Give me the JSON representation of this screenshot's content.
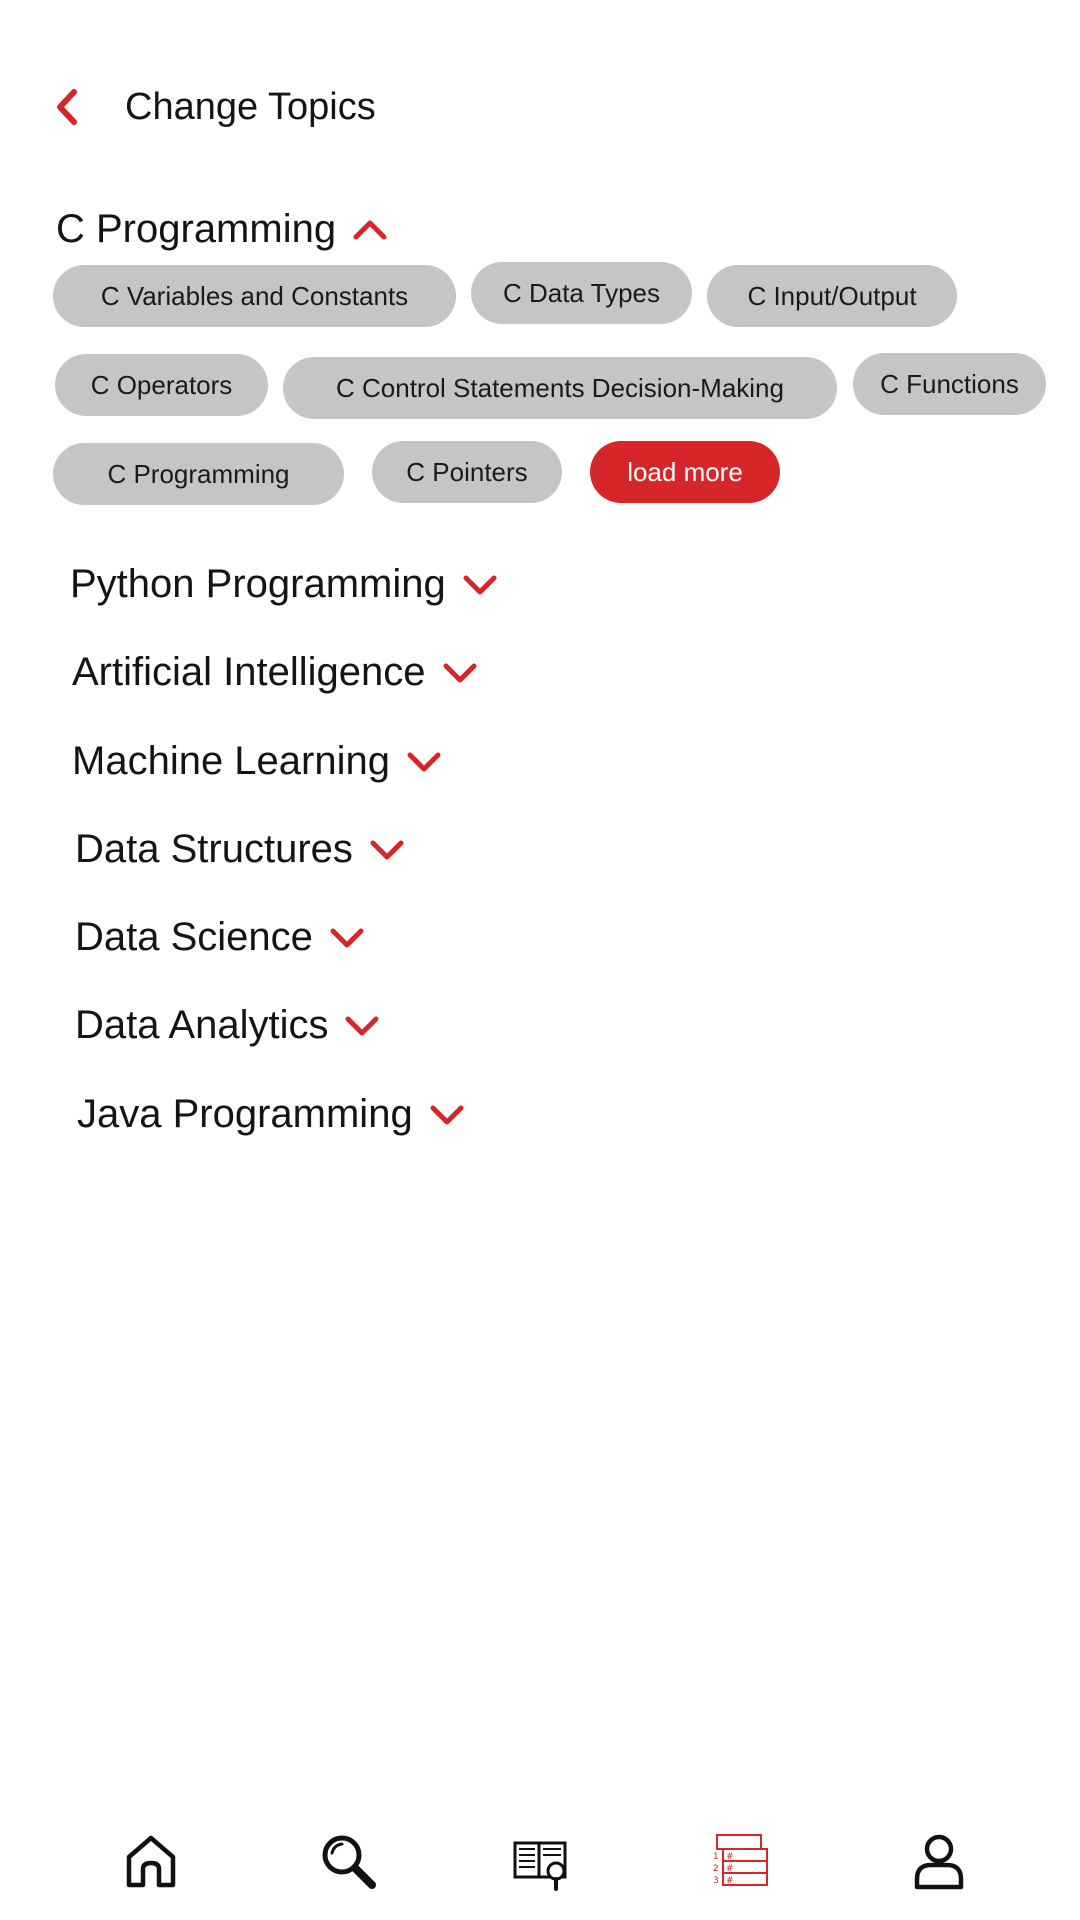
{
  "header": {
    "title": "Change Topics"
  },
  "expanded_section": {
    "title": "C Programming",
    "chips": [
      "C Variables and Constants",
      "C Data Types",
      "C Input/Output",
      "C Operators",
      "C Control Statements Decision-Making",
      "C Functions",
      "C Programming",
      "C Pointers"
    ],
    "load_more_label": "load more"
  },
  "collapsed_sections": [
    "Python Programming",
    "Artificial Intelligence",
    "Machine Learning",
    "Data Structures",
    "Data Science",
    "Data Analytics",
    "Java Programming"
  ],
  "bottom_nav": {
    "items": [
      "home-icon",
      "search-icon",
      "book-search-icon",
      "topics-list-icon",
      "profile-icon"
    ],
    "active": "topics-list-icon"
  },
  "colors": {
    "accent": "#d72629",
    "chip": "#c5c5c5",
    "text": "#141414"
  }
}
